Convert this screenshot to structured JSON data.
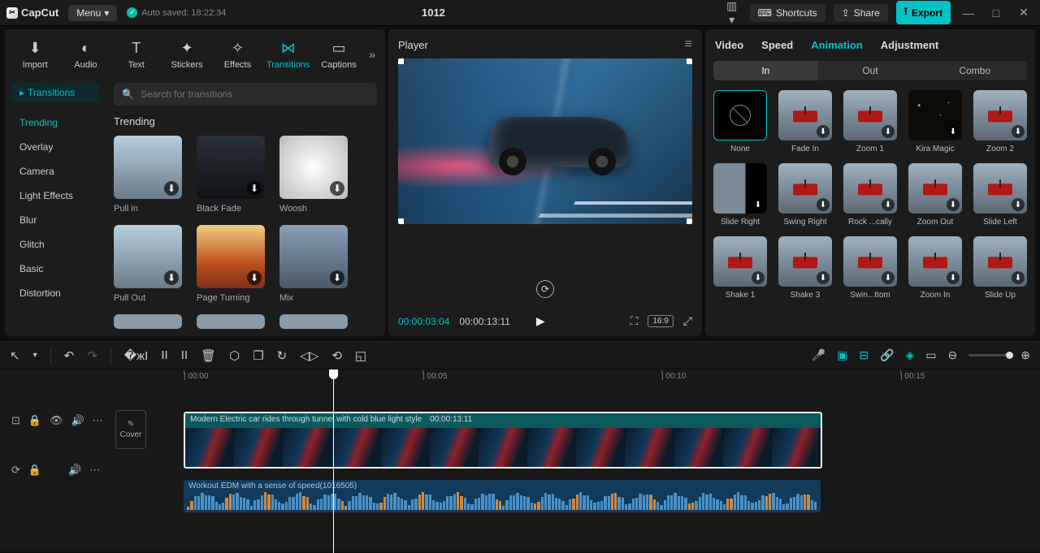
{
  "app": {
    "name": "CapCut",
    "menu_label": "Menu",
    "autosave": "Auto saved: 18:22:34",
    "project_title": "1012"
  },
  "topbar": {
    "shortcuts": "Shortcuts",
    "share": "Share",
    "export": "Export"
  },
  "tool_tabs": [
    {
      "label": "Import",
      "icon": "⬇"
    },
    {
      "label": "Audio",
      "icon": "◐"
    },
    {
      "label": "Text",
      "icon": "T"
    },
    {
      "label": "Stickers",
      "icon": "✦"
    },
    {
      "label": "Effects",
      "icon": "✧"
    },
    {
      "label": "Transitions",
      "icon": "⋈",
      "active": true
    },
    {
      "label": "Captions",
      "icon": "▭"
    }
  ],
  "cat_pill": "Transitions",
  "categories": [
    "Trending",
    "Overlay",
    "Camera",
    "Light Effects",
    "Blur",
    "Glitch",
    "Basic",
    "Distortion"
  ],
  "active_category": "Trending",
  "search": {
    "placeholder": "Search for transitions"
  },
  "section": "Trending",
  "transitions": [
    {
      "name": "Pull in",
      "cls": "th-city"
    },
    {
      "name": "Black Fade",
      "cls": "th-tower"
    },
    {
      "name": "Woosh",
      "cls": "th-blur"
    },
    {
      "name": "Pull Out",
      "cls": "th-city"
    },
    {
      "name": "Page Turning",
      "cls": "th-sun"
    },
    {
      "name": "Mix",
      "cls": "th-la"
    },
    {
      "name": "",
      "cls": "th-half"
    },
    {
      "name": "",
      "cls": "th-half"
    },
    {
      "name": "",
      "cls": "th-half"
    }
  ],
  "player": {
    "title": "Player",
    "current": "00:00:03:04",
    "total": "00:00:13:11",
    "ratio": "16:9"
  },
  "rp_tabs": [
    "Video",
    "Speed",
    "Animation",
    "Adjustment"
  ],
  "rp_active": "Animation",
  "segments": [
    "In",
    "Out",
    "Combo"
  ],
  "seg_active": "In",
  "animations": [
    {
      "name": "None",
      "type": "none"
    },
    {
      "name": "Fade In",
      "type": "cable"
    },
    {
      "name": "Zoom 1",
      "type": "cable"
    },
    {
      "name": "Kira Magic",
      "type": "stars"
    },
    {
      "name": "Zoom 2",
      "type": "cable"
    },
    {
      "name": "Slide Right",
      "type": "darkr"
    },
    {
      "name": "Swing Right",
      "type": "cable"
    },
    {
      "name": "Rock ...cally",
      "type": "cable"
    },
    {
      "name": "Zoom Out",
      "type": "cable"
    },
    {
      "name": "Slide Left",
      "type": "cable"
    },
    {
      "name": "Shake 1",
      "type": "cable"
    },
    {
      "name": "Shake 3",
      "type": "cable"
    },
    {
      "name": "Swin...ttom",
      "type": "cable"
    },
    {
      "name": "Zoom In",
      "type": "cable"
    },
    {
      "name": "Slide Up",
      "type": "cable"
    }
  ],
  "ruler": [
    "00:00",
    "00:05",
    "00:10",
    "00:15"
  ],
  "clip": {
    "title": "Modern Electric car rides through tunnel with cold blue light style",
    "dur": "00:00:13:11"
  },
  "audio": {
    "title": "Workout EDM with a sense of speed(1016505)"
  },
  "cover_label": "Cover"
}
